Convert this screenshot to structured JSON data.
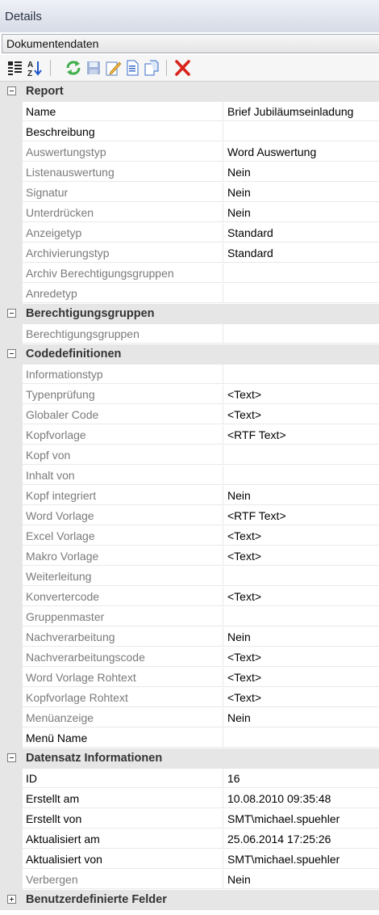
{
  "panel": {
    "title": "Details"
  },
  "selector": {
    "value": "Dokumentendaten"
  },
  "toolbar": {
    "buttons": [
      {
        "name": "categorized-sort-button",
        "icon": "categorized-icon"
      },
      {
        "name": "alphabetical-sort-button",
        "icon": "sort-az-icon"
      },
      {
        "name": "refresh-button",
        "icon": "refresh-icon"
      },
      {
        "name": "save-button",
        "icon": "save-icon"
      },
      {
        "name": "edit-button",
        "icon": "edit-icon"
      },
      {
        "name": "document-button",
        "icon": "document-icon"
      },
      {
        "name": "copy-button",
        "icon": "copy-icon"
      },
      {
        "name": "delete-button",
        "icon": "delete-icon"
      }
    ],
    "colors": {
      "refresh": "#3fae4a",
      "delete": "#d9241c",
      "save": "#4a6fb5",
      "doc": "#3a6cc9"
    }
  },
  "grid": {
    "rows": [
      {
        "type": "cat",
        "label": "Report",
        "expanded": true
      },
      {
        "type": "prop",
        "name": "Name",
        "value": "Brief Jubiläumseinladung",
        "readonly": false
      },
      {
        "type": "prop",
        "name": "Beschreibung",
        "value": "",
        "readonly": false
      },
      {
        "type": "prop",
        "name": "Auswertungstyp",
        "value": "Word Auswertung",
        "readonly": true
      },
      {
        "type": "prop",
        "name": "Listenauswertung",
        "value": "Nein",
        "readonly": true
      },
      {
        "type": "prop",
        "name": "Signatur",
        "value": "Nein",
        "readonly": true
      },
      {
        "type": "prop",
        "name": "Unterdrücken",
        "value": "Nein",
        "readonly": true
      },
      {
        "type": "prop",
        "name": "Anzeigetyp",
        "value": "Standard",
        "readonly": true
      },
      {
        "type": "prop",
        "name": "Archivierungstyp",
        "value": "Standard",
        "readonly": true
      },
      {
        "type": "prop",
        "name": "Archiv Berechtigungsgruppen",
        "value": "",
        "readonly": true
      },
      {
        "type": "prop",
        "name": "Anredetyp",
        "value": "",
        "readonly": true
      },
      {
        "type": "cat",
        "label": "Berechtigungsgruppen",
        "expanded": true
      },
      {
        "type": "prop",
        "name": "Berechtigungsgruppen",
        "value": "",
        "readonly": true
      },
      {
        "type": "cat",
        "label": "Codedefinitionen",
        "expanded": true
      },
      {
        "type": "prop",
        "name": "Informationstyp",
        "value": "",
        "readonly": true
      },
      {
        "type": "prop",
        "name": "Typenprüfung",
        "value": "<Text>",
        "readonly": true
      },
      {
        "type": "prop",
        "name": "Globaler Code",
        "value": "<Text>",
        "readonly": true
      },
      {
        "type": "prop",
        "name": "Kopfvorlage",
        "value": "<RTF Text>",
        "readonly": true
      },
      {
        "type": "prop",
        "name": "Kopf von",
        "value": "",
        "readonly": true
      },
      {
        "type": "prop",
        "name": "Inhalt von",
        "value": "",
        "readonly": true
      },
      {
        "type": "prop",
        "name": "Kopf integriert",
        "value": "Nein",
        "readonly": true
      },
      {
        "type": "prop",
        "name": "Word Vorlage",
        "value": "<RTF Text>",
        "readonly": true
      },
      {
        "type": "prop",
        "name": "Excel Vorlage",
        "value": "<Text>",
        "readonly": true
      },
      {
        "type": "prop",
        "name": "Makro Vorlage",
        "value": "<Text>",
        "readonly": true
      },
      {
        "type": "prop",
        "name": "Weiterleitung",
        "value": "",
        "readonly": true
      },
      {
        "type": "prop",
        "name": "Konvertercode",
        "value": "<Text>",
        "readonly": true
      },
      {
        "type": "prop",
        "name": "Gruppenmaster",
        "value": "",
        "readonly": true
      },
      {
        "type": "prop",
        "name": "Nachverarbeitung",
        "value": "Nein",
        "readonly": true
      },
      {
        "type": "prop",
        "name": "Nachverarbeitungscode",
        "value": "<Text>",
        "readonly": true
      },
      {
        "type": "prop",
        "name": "Word Vorlage Rohtext",
        "value": "<Text>",
        "readonly": true
      },
      {
        "type": "prop",
        "name": "Kopfvorlage Rohtext",
        "value": "<Text>",
        "readonly": true
      },
      {
        "type": "prop",
        "name": "Menüanzeige",
        "value": "Nein",
        "readonly": true
      },
      {
        "type": "prop",
        "name": "Menü Name",
        "value": "",
        "readonly": false
      },
      {
        "type": "cat",
        "label": "Datensatz Informationen",
        "expanded": true
      },
      {
        "type": "prop",
        "name": "ID",
        "value": "16",
        "readonly": false
      },
      {
        "type": "prop",
        "name": "Erstellt am",
        "value": "10.08.2010 09:35:48",
        "readonly": false
      },
      {
        "type": "prop",
        "name": "Erstellt von",
        "value": "SMT\\michael.spuehler",
        "readonly": false
      },
      {
        "type": "prop",
        "name": "Aktualisiert am",
        "value": "25.06.2014 17:25:26",
        "readonly": false
      },
      {
        "type": "prop",
        "name": "Aktualisiert von",
        "value": "SMT\\michael.spuehler",
        "readonly": false
      },
      {
        "type": "prop",
        "name": "Verbergen",
        "value": "Nein",
        "readonly": true
      },
      {
        "type": "cat",
        "label": "Benutzerdefinierte Felder",
        "expanded": false
      }
    ]
  }
}
